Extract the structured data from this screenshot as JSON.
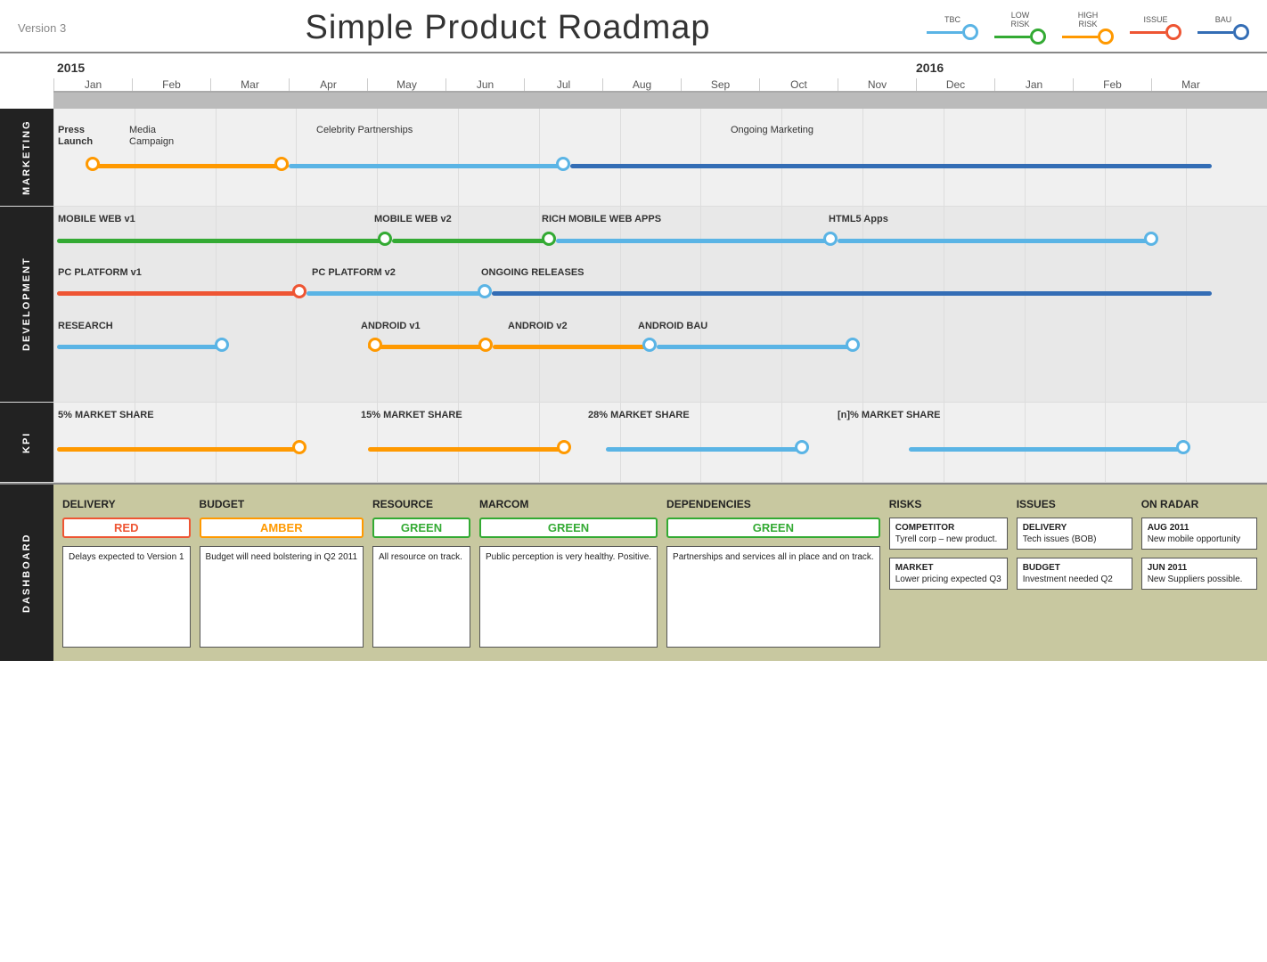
{
  "header": {
    "version": "Version 3",
    "title": "Simple Product Roadmap",
    "legend": [
      {
        "label": "TBC",
        "color": "#5ab4e5",
        "line_color": "#5ab4e5"
      },
      {
        "label": "LOW\nRISK",
        "color": "#3a3",
        "line_color": "#3a3"
      },
      {
        "label": "HIGH\nRISK",
        "color": "#f90",
        "line_color": "#f90"
      },
      {
        "label": "ISSUE",
        "color": "#e53",
        "line_color": "#e53"
      },
      {
        "label": "BAU",
        "color": "#336db5",
        "line_color": "#336db5"
      }
    ]
  },
  "timeline": {
    "years": [
      {
        "label": "2015",
        "col_start": 0
      },
      {
        "label": "2016",
        "col_start": 11
      }
    ],
    "months": [
      "Jan",
      "Feb",
      "Mar",
      "Apr",
      "May",
      "Jun",
      "Jul",
      "Aug",
      "Sep",
      "Oct",
      "Nov",
      "Dec",
      "Jan",
      "Feb",
      "Mar"
    ]
  },
  "sections": [
    {
      "label": "MARKETING",
      "rows": [
        {
          "label_text": "Press Launch",
          "label_text2": "Media Campaign",
          "label_text3": "Celebrity Partnerships",
          "label_text4": "Ongoing Marketing"
        }
      ]
    },
    {
      "label": "DEVELOPMENT",
      "rows": []
    },
    {
      "label": "KPI",
      "rows": []
    }
  ],
  "dashboard": {
    "label": "DASHBOARD",
    "cols": [
      {
        "header": "DELIVERY",
        "badge": "RED",
        "badge_type": "red",
        "text": "Delays expected to Version 1"
      },
      {
        "header": "BUDGET",
        "badge": "AMBER",
        "badge_type": "amber",
        "text": "Budget will need bolstering in Q2 2011"
      },
      {
        "header": "RESOURCE",
        "badge": "GREEN",
        "badge_type": "green",
        "text": "All resource on track."
      },
      {
        "header": "MARCOM",
        "badge": "GREEN",
        "badge_type": "green",
        "text": "Public perception is very healthy. Positive."
      },
      {
        "header": "DEPENDENCIES",
        "badge": "GREEN",
        "badge_type": "green",
        "text": "Partnerships and services all in place and on track."
      },
      {
        "header": "RISKS",
        "risks": [
          {
            "title": "COMPETITOR",
            "text": "Tyrell corp – new product."
          },
          {
            "title": "MARKET",
            "text": "Lower pricing expected Q3"
          }
        ]
      },
      {
        "header": "ISSUES",
        "risks": [
          {
            "title": "DELIVERY",
            "text": "Tech issues (BOB)"
          },
          {
            "title": "BUDGET",
            "text": "Investment needed Q2"
          }
        ]
      },
      {
        "header": "ON RADAR",
        "risks": [
          {
            "title": "AUG 2011",
            "text": "New mobile opportunity"
          },
          {
            "title": "JUN 2011",
            "text": "New Suppliers possible."
          }
        ]
      }
    ]
  }
}
